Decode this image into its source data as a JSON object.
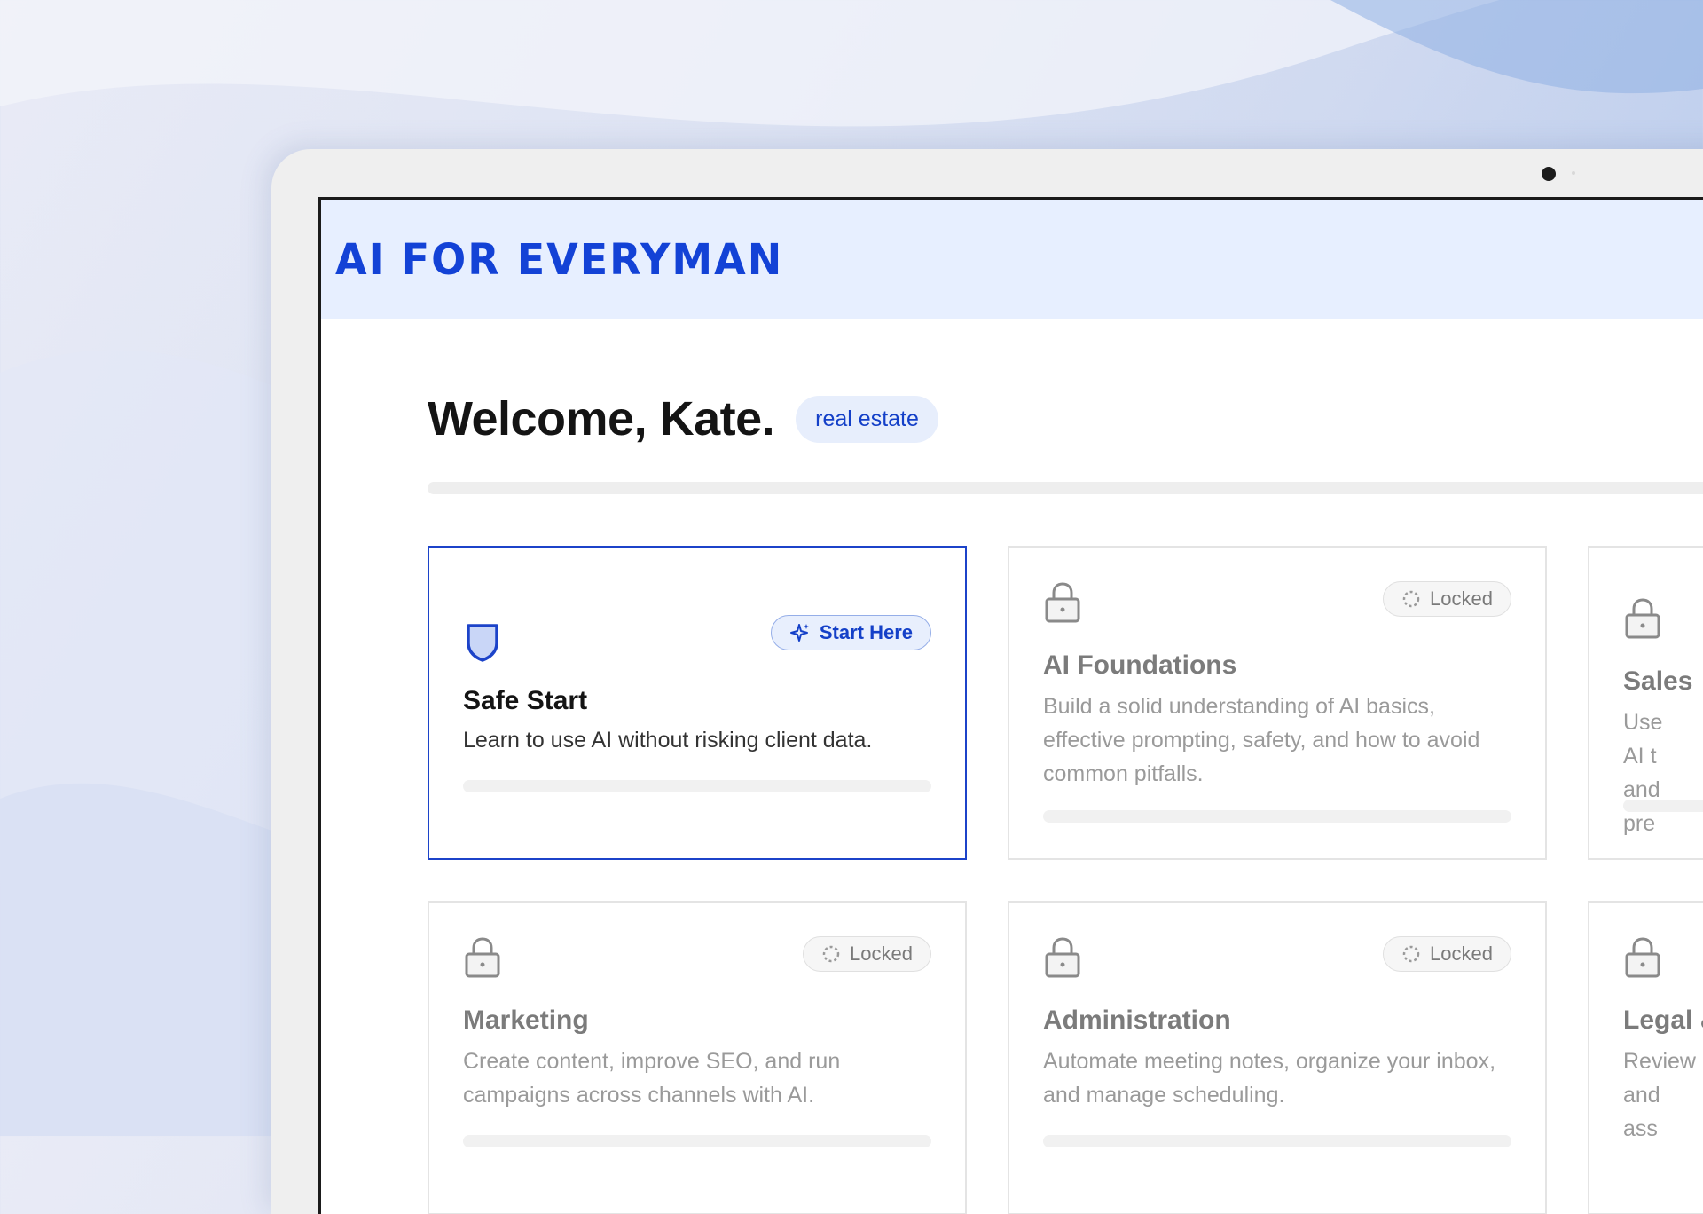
{
  "header": {
    "brand": "AI FOR EVERYMAN"
  },
  "welcome": {
    "greeting": "Welcome, Kate.",
    "industry_tag": "real estate"
  },
  "modules": [
    {
      "title": "Safe Start",
      "description": "Learn to use AI without risking client data.",
      "badge": "Start Here",
      "status": "start",
      "icon": "shield-icon"
    },
    {
      "title": "AI Foundations",
      "description": "Build a solid understanding of AI basics, effective prompting, safety, and how to avoid common pitfalls.",
      "badge": "Locked",
      "status": "locked",
      "icon": "lock-icon"
    },
    {
      "title": "Sales",
      "description": "Use AI t and pre",
      "badge": "",
      "status": "locked",
      "icon": "lock-icon"
    },
    {
      "title": "Marketing",
      "description": "Create content, improve SEO, and run campaigns across channels with AI.",
      "badge": "Locked",
      "status": "locked",
      "icon": "lock-icon"
    },
    {
      "title": "Administration",
      "description": "Automate meeting notes, organize your inbox, and manage scheduling.",
      "badge": "Locked",
      "status": "locked",
      "icon": "lock-icon"
    },
    {
      "title": "Legal &",
      "description": "Review and ass",
      "badge": "",
      "status": "locked",
      "icon": "lock-icon"
    }
  ],
  "colors": {
    "accent": "#1342d6",
    "header_bg": "#e7efff",
    "tag_bg": "#e7eefc"
  }
}
